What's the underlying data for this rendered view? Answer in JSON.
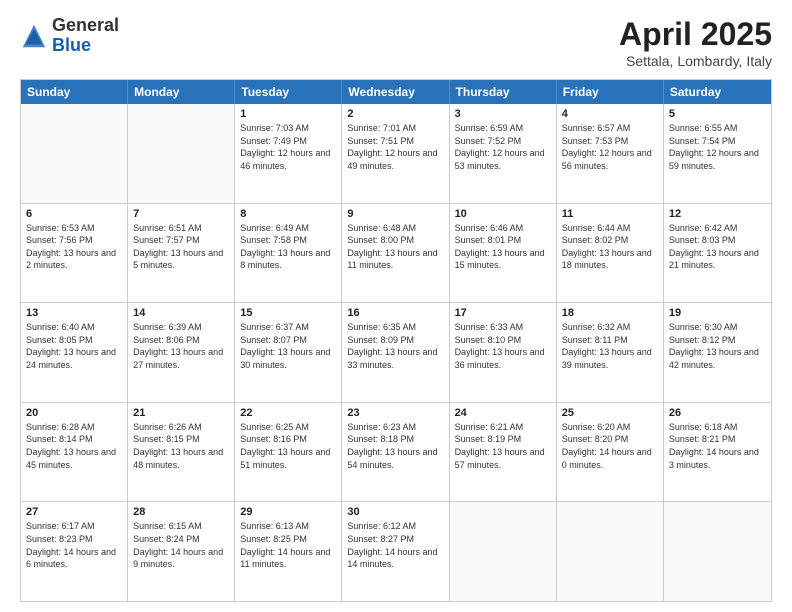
{
  "header": {
    "logo_general": "General",
    "logo_blue": "Blue",
    "month_year": "April 2025",
    "location": "Settala, Lombardy, Italy"
  },
  "days_of_week": [
    "Sunday",
    "Monday",
    "Tuesday",
    "Wednesday",
    "Thursday",
    "Friday",
    "Saturday"
  ],
  "weeks": [
    [
      {
        "day": "",
        "empty": true
      },
      {
        "day": "",
        "empty": true
      },
      {
        "day": "1",
        "sunrise": "Sunrise: 7:03 AM",
        "sunset": "Sunset: 7:49 PM",
        "daylight": "Daylight: 12 hours and 46 minutes."
      },
      {
        "day": "2",
        "sunrise": "Sunrise: 7:01 AM",
        "sunset": "Sunset: 7:51 PM",
        "daylight": "Daylight: 12 hours and 49 minutes."
      },
      {
        "day": "3",
        "sunrise": "Sunrise: 6:59 AM",
        "sunset": "Sunset: 7:52 PM",
        "daylight": "Daylight: 12 hours and 53 minutes."
      },
      {
        "day": "4",
        "sunrise": "Sunrise: 6:57 AM",
        "sunset": "Sunset: 7:53 PM",
        "daylight": "Daylight: 12 hours and 56 minutes."
      },
      {
        "day": "5",
        "sunrise": "Sunrise: 6:55 AM",
        "sunset": "Sunset: 7:54 PM",
        "daylight": "Daylight: 12 hours and 59 minutes."
      }
    ],
    [
      {
        "day": "6",
        "sunrise": "Sunrise: 6:53 AM",
        "sunset": "Sunset: 7:56 PM",
        "daylight": "Daylight: 13 hours and 2 minutes."
      },
      {
        "day": "7",
        "sunrise": "Sunrise: 6:51 AM",
        "sunset": "Sunset: 7:57 PM",
        "daylight": "Daylight: 13 hours and 5 minutes."
      },
      {
        "day": "8",
        "sunrise": "Sunrise: 6:49 AM",
        "sunset": "Sunset: 7:58 PM",
        "daylight": "Daylight: 13 hours and 8 minutes."
      },
      {
        "day": "9",
        "sunrise": "Sunrise: 6:48 AM",
        "sunset": "Sunset: 8:00 PM",
        "daylight": "Daylight: 13 hours and 11 minutes."
      },
      {
        "day": "10",
        "sunrise": "Sunrise: 6:46 AM",
        "sunset": "Sunset: 8:01 PM",
        "daylight": "Daylight: 13 hours and 15 minutes."
      },
      {
        "day": "11",
        "sunrise": "Sunrise: 6:44 AM",
        "sunset": "Sunset: 8:02 PM",
        "daylight": "Daylight: 13 hours and 18 minutes."
      },
      {
        "day": "12",
        "sunrise": "Sunrise: 6:42 AM",
        "sunset": "Sunset: 8:03 PM",
        "daylight": "Daylight: 13 hours and 21 minutes."
      }
    ],
    [
      {
        "day": "13",
        "sunrise": "Sunrise: 6:40 AM",
        "sunset": "Sunset: 8:05 PM",
        "daylight": "Daylight: 13 hours and 24 minutes."
      },
      {
        "day": "14",
        "sunrise": "Sunrise: 6:39 AM",
        "sunset": "Sunset: 8:06 PM",
        "daylight": "Daylight: 13 hours and 27 minutes."
      },
      {
        "day": "15",
        "sunrise": "Sunrise: 6:37 AM",
        "sunset": "Sunset: 8:07 PM",
        "daylight": "Daylight: 13 hours and 30 minutes."
      },
      {
        "day": "16",
        "sunrise": "Sunrise: 6:35 AM",
        "sunset": "Sunset: 8:09 PM",
        "daylight": "Daylight: 13 hours and 33 minutes."
      },
      {
        "day": "17",
        "sunrise": "Sunrise: 6:33 AM",
        "sunset": "Sunset: 8:10 PM",
        "daylight": "Daylight: 13 hours and 36 minutes."
      },
      {
        "day": "18",
        "sunrise": "Sunrise: 6:32 AM",
        "sunset": "Sunset: 8:11 PM",
        "daylight": "Daylight: 13 hours and 39 minutes."
      },
      {
        "day": "19",
        "sunrise": "Sunrise: 6:30 AM",
        "sunset": "Sunset: 8:12 PM",
        "daylight": "Daylight: 13 hours and 42 minutes."
      }
    ],
    [
      {
        "day": "20",
        "sunrise": "Sunrise: 6:28 AM",
        "sunset": "Sunset: 8:14 PM",
        "daylight": "Daylight: 13 hours and 45 minutes."
      },
      {
        "day": "21",
        "sunrise": "Sunrise: 6:26 AM",
        "sunset": "Sunset: 8:15 PM",
        "daylight": "Daylight: 13 hours and 48 minutes."
      },
      {
        "day": "22",
        "sunrise": "Sunrise: 6:25 AM",
        "sunset": "Sunset: 8:16 PM",
        "daylight": "Daylight: 13 hours and 51 minutes."
      },
      {
        "day": "23",
        "sunrise": "Sunrise: 6:23 AM",
        "sunset": "Sunset: 8:18 PM",
        "daylight": "Daylight: 13 hours and 54 minutes."
      },
      {
        "day": "24",
        "sunrise": "Sunrise: 6:21 AM",
        "sunset": "Sunset: 8:19 PM",
        "daylight": "Daylight: 13 hours and 57 minutes."
      },
      {
        "day": "25",
        "sunrise": "Sunrise: 6:20 AM",
        "sunset": "Sunset: 8:20 PM",
        "daylight": "Daylight: 14 hours and 0 minutes."
      },
      {
        "day": "26",
        "sunrise": "Sunrise: 6:18 AM",
        "sunset": "Sunset: 8:21 PM",
        "daylight": "Daylight: 14 hours and 3 minutes."
      }
    ],
    [
      {
        "day": "27",
        "sunrise": "Sunrise: 6:17 AM",
        "sunset": "Sunset: 8:23 PM",
        "daylight": "Daylight: 14 hours and 6 minutes."
      },
      {
        "day": "28",
        "sunrise": "Sunrise: 6:15 AM",
        "sunset": "Sunset: 8:24 PM",
        "daylight": "Daylight: 14 hours and 9 minutes."
      },
      {
        "day": "29",
        "sunrise": "Sunrise: 6:13 AM",
        "sunset": "Sunset: 8:25 PM",
        "daylight": "Daylight: 14 hours and 11 minutes."
      },
      {
        "day": "30",
        "sunrise": "Sunrise: 6:12 AM",
        "sunset": "Sunset: 8:27 PM",
        "daylight": "Daylight: 14 hours and 14 minutes."
      },
      {
        "day": "",
        "empty": true
      },
      {
        "day": "",
        "empty": true
      },
      {
        "day": "",
        "empty": true
      }
    ]
  ]
}
